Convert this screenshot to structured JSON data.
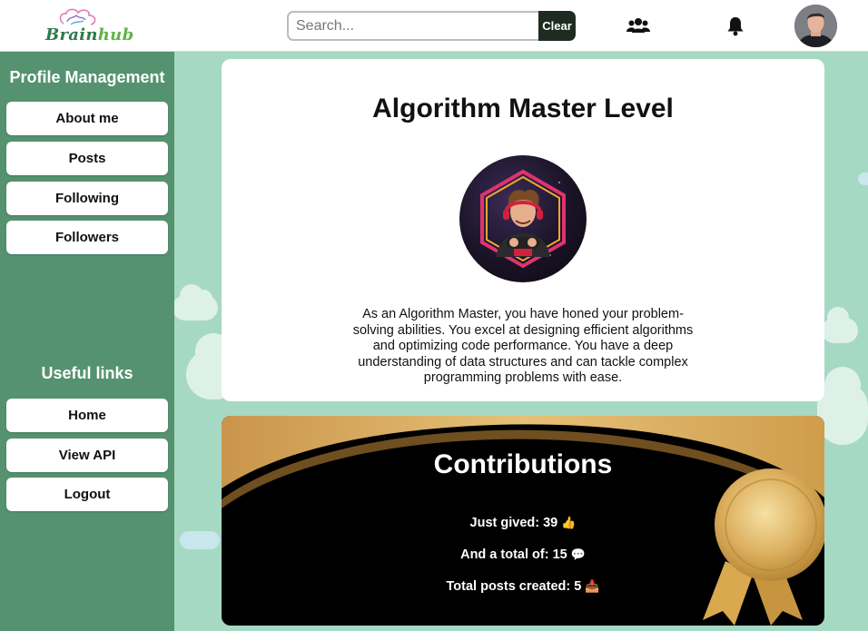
{
  "header": {
    "logo": {
      "text_part1": "Brain",
      "text_part2": "hub"
    },
    "search": {
      "placeholder": "Search...",
      "clear_label": "Clear"
    },
    "icons": [
      "friends-icon",
      "bell-icon"
    ],
    "colors": {
      "clear_bg": "#1d2b21",
      "logo_green": "#2f7a4b",
      "logo_light_green": "#62b24a"
    }
  },
  "sidebar": {
    "profile_heading": "Profile Management",
    "profile_items": [
      {
        "label": "About me"
      },
      {
        "label": "Posts"
      },
      {
        "label": "Following"
      },
      {
        "label": "Followers"
      }
    ],
    "links_heading": "Useful links",
    "link_items": [
      {
        "label": "Home"
      },
      {
        "label": "View API"
      },
      {
        "label": "Logout"
      }
    ],
    "colors": {
      "background": "#55926f"
    }
  },
  "level_card": {
    "title": "Algorithm Master Level",
    "description": "As an Algorithm Master, you have honed your problem-solving abilities. You excel at designing efficient algorithms and optimizing code performance. You have a deep understanding of data structures and can tackle complex programming problems with ease."
  },
  "contributions": {
    "title": "Contributions",
    "stats": [
      {
        "text": "Just gived: 39",
        "icon": "thumbs-up-icon",
        "glyph": "👍"
      },
      {
        "text": "And a total of: 15",
        "icon": "comment-icon",
        "glyph": "💬"
      },
      {
        "text": "Total posts created: 5",
        "icon": "inbox-tray-icon",
        "glyph": "📥"
      }
    ],
    "colors": {
      "gold": "#d4a24c",
      "background": "#000000"
    }
  },
  "page": {
    "background": "#a6d9c3"
  }
}
